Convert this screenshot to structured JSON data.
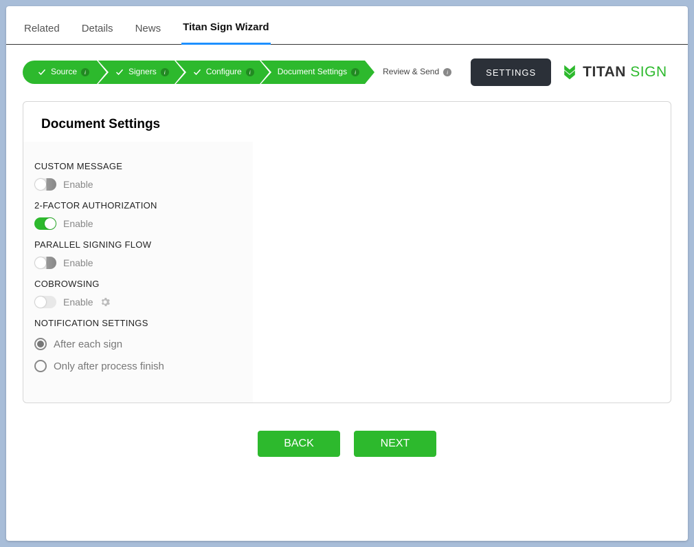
{
  "tabs": [
    {
      "label": "Related",
      "active": false
    },
    {
      "label": "Details",
      "active": false
    },
    {
      "label": "News",
      "active": false
    },
    {
      "label": "Titan Sign Wizard",
      "active": true
    }
  ],
  "steps": [
    {
      "label": "Source",
      "done": true,
      "style": "green"
    },
    {
      "label": "Signers",
      "done": true,
      "style": "green"
    },
    {
      "label": "Configure",
      "done": true,
      "style": "green"
    },
    {
      "label": "Document Settings",
      "done": false,
      "style": "green"
    },
    {
      "label": "Review & Send",
      "done": false,
      "style": "white"
    }
  ],
  "settings_btn": "SETTINGS",
  "brand": {
    "titan": "TITAN",
    "sign": " SIGN"
  },
  "panel": {
    "title": "Document Settings",
    "custom_message": {
      "heading": "CUSTOM MESSAGE",
      "label": "Enable",
      "on": false
    },
    "two_factor": {
      "heading": "2-FACTOR AUTHORIZATION",
      "label": "Enable",
      "on": true
    },
    "parallel": {
      "heading": "PARALLEL SIGNING FLOW",
      "label": "Enable",
      "on": false
    },
    "cobrowsing": {
      "heading": "COBROWSING",
      "label": "Enable",
      "on": false
    },
    "notification": {
      "heading": "NOTIFICATION SETTINGS",
      "options": [
        {
          "label": "After each sign",
          "selected": true
        },
        {
          "label": "Only after process finish",
          "selected": false
        }
      ]
    }
  },
  "buttons": {
    "back": "BACK",
    "next": "NEXT"
  }
}
